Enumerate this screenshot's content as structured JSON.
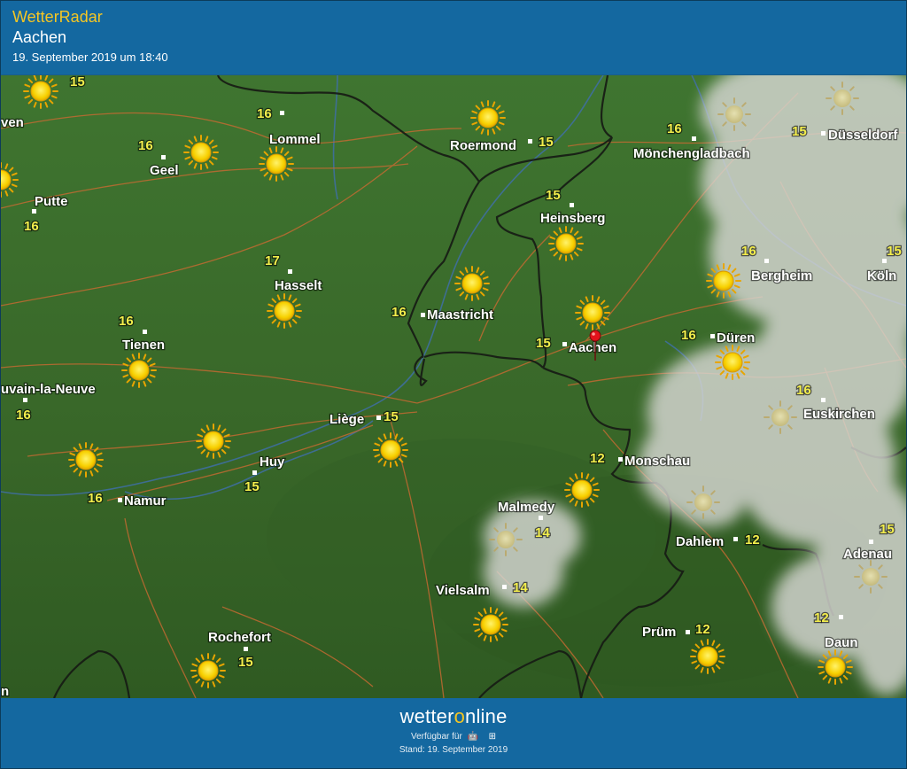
{
  "header": {
    "app_title": "WetterRadar",
    "location": "Aachen",
    "timestamp": "19. September 2019 um 18:40"
  },
  "footer": {
    "brand_pre": "wetter",
    "brand_o": "o",
    "brand_post": "nline",
    "available_label": "Verfügbar für",
    "stand": "Stand: 19. September 2019"
  },
  "colors": {
    "header_bg": "#1468a0",
    "accent_yellow": "#f5c623",
    "map_green": "#3e6e2a",
    "temperature_text": "#f3ee4c"
  },
  "map": {
    "cities": [
      {
        "name": "ven"
      },
      {
        "name": "Lommel"
      },
      {
        "name": "Geel"
      },
      {
        "name": "Roermond"
      },
      {
        "name": "Mönchengladbach"
      },
      {
        "name": "Düsseldorf"
      },
      {
        "name": "Putte"
      },
      {
        "name": "Heinsberg"
      },
      {
        "name": "Hasselt"
      },
      {
        "name": "Bergheim"
      },
      {
        "name": "Köln"
      },
      {
        "name": "Maastricht"
      },
      {
        "name": "Tienen"
      },
      {
        "name": "Aachen"
      },
      {
        "name": "Düren"
      },
      {
        "name": "uvain-la-Neuve"
      },
      {
        "name": "Euskirchen"
      },
      {
        "name": "Liège"
      },
      {
        "name": "Huy"
      },
      {
        "name": "Monschau"
      },
      {
        "name": "Namur"
      },
      {
        "name": "Malmedy"
      },
      {
        "name": "Dahlem"
      },
      {
        "name": "Adenau"
      },
      {
        "name": "Vielsalm"
      },
      {
        "name": "Rochefort"
      },
      {
        "name": "Prüm"
      },
      {
        "name": "Daun"
      },
      {
        "name": "n"
      }
    ],
    "temperatures": [
      "15",
      "16",
      "16",
      "15",
      "16",
      "15",
      "15",
      "16",
      "17",
      "16",
      "15",
      "16",
      "16",
      "15",
      "16",
      "16",
      "16",
      "15",
      "12",
      "16",
      "15",
      "14",
      "12",
      "15",
      "14",
      "12",
      "15",
      "12"
    ],
    "weather_icons": [
      "sun-icon",
      "cloud-icon",
      "partly-cloudy-icon"
    ],
    "marker": "location-pin-icon"
  }
}
